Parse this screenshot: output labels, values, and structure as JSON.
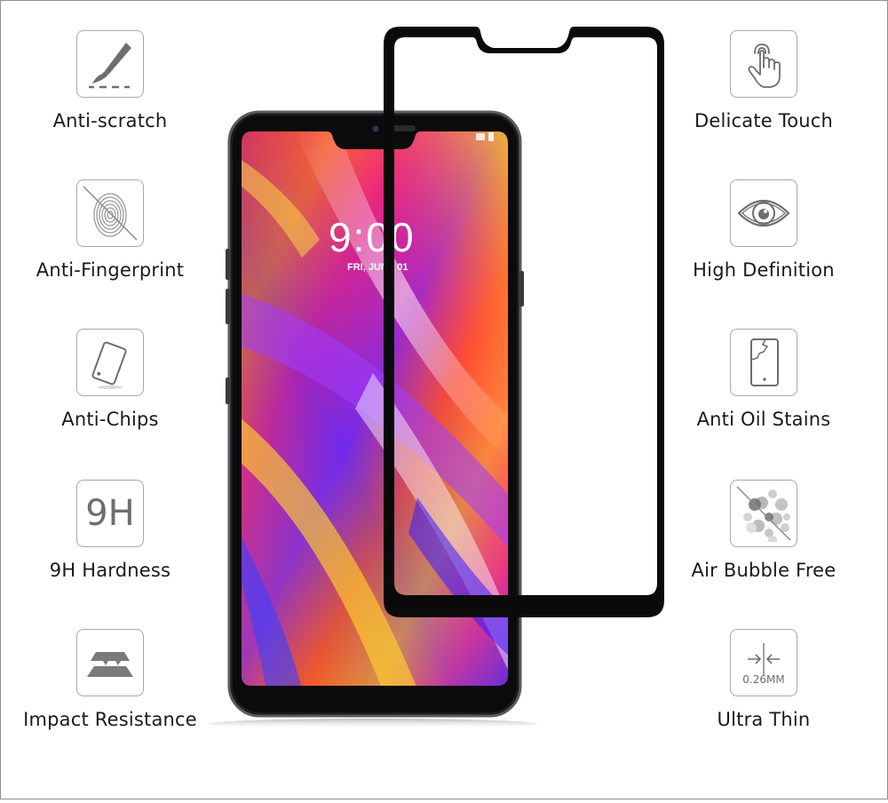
{
  "features_left": [
    {
      "icon": "scalpel-scratch-icon",
      "label": "Anti-scratch"
    },
    {
      "icon": "crossed-fingerprint-icon",
      "label": "Anti-Fingerprint"
    },
    {
      "icon": "tilted-phone-icon",
      "label": "Anti-Chips"
    },
    {
      "icon": "9h-hardness-icon",
      "label": "9H Hardness",
      "icon_text": "9H"
    },
    {
      "icon": "impact-layers-icon",
      "label": "Impact Resistance"
    }
  ],
  "features_right": [
    {
      "icon": "touch-hand-icon",
      "label": "Delicate Touch"
    },
    {
      "icon": "eye-icon",
      "label": "High Definition"
    },
    {
      "icon": "cracked-phone-icon",
      "label": "Anti Oil Stains"
    },
    {
      "icon": "crossed-bubbles-icon",
      "label": "Air Bubble Free"
    },
    {
      "icon": "thickness-arrows-icon",
      "label": "Ultra Thin",
      "icon_text": "0.26MM"
    }
  ],
  "phone": {
    "lock_time": "9:00",
    "lock_date": "FRI, JUNE 01"
  },
  "colors": {
    "icon_gray": "#6e6e6e",
    "border_gray": "#a8a8a8",
    "protector_black": "#0a0a0a"
  }
}
